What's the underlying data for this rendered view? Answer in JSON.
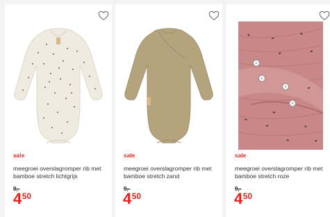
{
  "products": [
    {
      "badge": "sale",
      "title": "meegroei overslagromper rib met bamboe stretch lichtgrijs",
      "old_price": "9,-",
      "price_int": "4",
      "price_dec": "50",
      "favorite_icon": "heart-outline-icon",
      "image_subject": "off-white bodysuit with dark speckle print",
      "colors": {
        "garment": "#eeeae0",
        "print": "#3a3a3a"
      }
    },
    {
      "badge": "sale",
      "title": "meegroei overslagromper rib met bamboe stretch zand",
      "old_price": "9,-",
      "price_int": "4",
      "price_dec": "50",
      "favorite_icon": "heart-outline-icon",
      "image_subject": "sand-colored wrap bodysuit",
      "colors": {
        "garment": "#b4a27c"
      }
    },
    {
      "badge": "sale",
      "title": "meegroei overslagromper rib met bamboe stretch roze",
      "old_price": "9,-",
      "price_int": "4",
      "price_dec": "50",
      "favorite_icon": "heart-outline-icon",
      "image_subject": "close-up of pink ribbed fabric with snap buttons",
      "colors": {
        "garment": "#c98a8a",
        "print": "#2f2f2f"
      }
    }
  ],
  "theme": {
    "accent": "#e2231a",
    "text": "#333333",
    "background": "#f3f3f3"
  }
}
